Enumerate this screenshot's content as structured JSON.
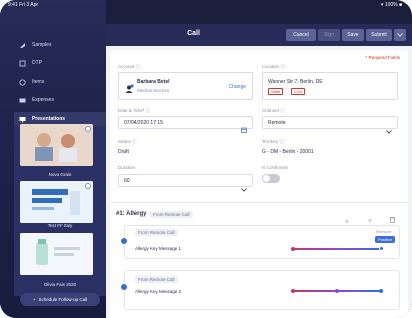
{
  "status_bar": {
    "time": "9:41 Fri 3 Apr",
    "right": "▾ 100% ■"
  },
  "sidebar": {
    "items": [
      {
        "label": "Samples",
        "icon": "samples-icon"
      },
      {
        "label": "DTP",
        "icon": "dtp-icon"
      },
      {
        "label": "Items",
        "icon": "items-icon"
      },
      {
        "label": "Expenses",
        "icon": "expenses-icon"
      },
      {
        "label": "Presentations",
        "icon": "presentations-icon"
      }
    ],
    "presentations": [
      {
        "caption": "Nova Grain"
      },
      {
        "caption": "Test FF Italy"
      },
      {
        "caption": "Olivia Fais 2020"
      }
    ],
    "follow_up_label": "Schedule Follow-up Call"
  },
  "header": {
    "title": "Call",
    "cancel": "Cancel",
    "sign": "Sign",
    "save": "Save",
    "submit": "Submit"
  },
  "form": {
    "required_note": "* Required Fields",
    "account_label": "Account ⓘ",
    "account_name": "Barbara Betel",
    "account_role": "Medical Doctors",
    "change": "Change",
    "location_label": "Location ⓘ",
    "location_value": "Wanner Str 7, Berlin, DE",
    "location_tags": [
      "State",
      "CXA"
    ],
    "datetime_label": "Date & Time",
    "datetime_value": "07/04/2020 17:15",
    "channel_label": "Channel ⓘ",
    "channel_value": "Remote",
    "status_label": "Status ⓘ",
    "status_value": "Draft",
    "territory_label": "Territory ⓘ",
    "territory_value": "G - DM - Berlin - 20001",
    "duration_label": "Duration",
    "duration_value": "60",
    "confirmed_label": "Is Confirmed"
  },
  "allergy": {
    "title": "#1: Allergy",
    "source_tag": "From Remote Call",
    "remove_label": "Remove",
    "positive_label": "Positive",
    "messages": [
      {
        "tag": "From Remote Call",
        "text": "Allergy Key Message 1"
      },
      {
        "tag": "From Remote Call",
        "text": "Allergy Key Message 2"
      }
    ]
  },
  "colors": {
    "accent": "#3b6fd8",
    "sidebar": "#262b57",
    "danger": "#d0342c",
    "slider_start": "#c8356f",
    "slider_end": "#2f6fe0"
  }
}
